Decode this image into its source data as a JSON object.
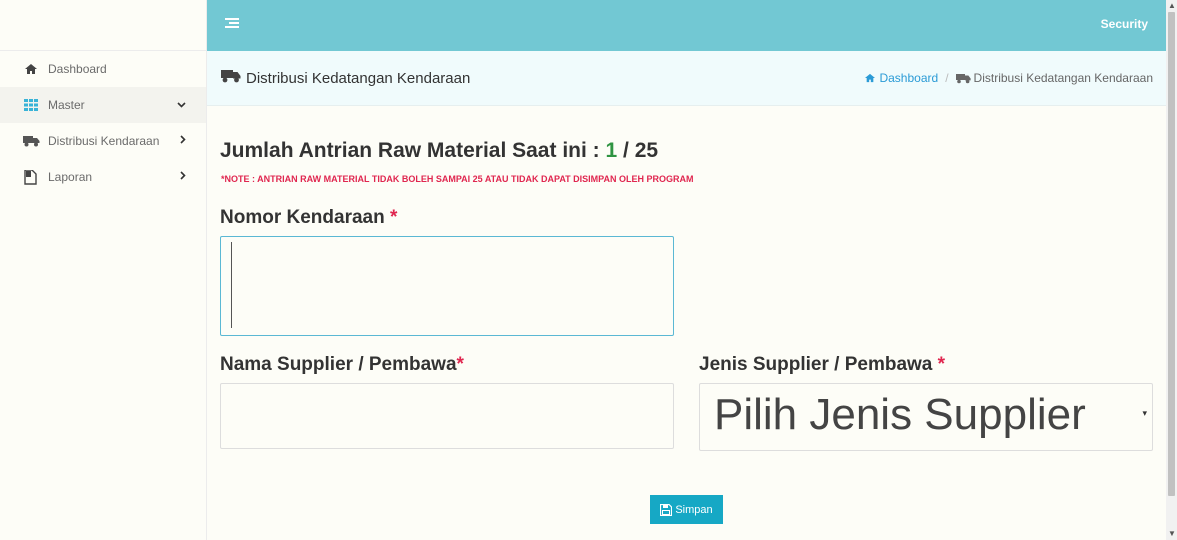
{
  "sidebar": {
    "items": [
      {
        "label": "Dashboard",
        "icon": "home-icon",
        "has_chevron": false
      },
      {
        "label": "Master",
        "icon": "grid-icon",
        "chevron": "down"
      },
      {
        "label": "Distribusi Kendaraan",
        "icon": "truck-icon",
        "chevron": "right"
      },
      {
        "label": "Laporan",
        "icon": "document-icon",
        "chevron": "right"
      }
    ]
  },
  "topbar": {
    "user_label": "Security",
    "bg_color": "#72c8d3"
  },
  "page_header": {
    "title": "Distribusi Kedatangan Kendaraan",
    "breadcrumb": {
      "home": "Dashboard",
      "current": "Distribusi Kedatangan Kendaraan"
    }
  },
  "main": {
    "queue_label": "Jumlah Antrian Raw Material Saat ini :",
    "queue_current": "1",
    "queue_separator": "/",
    "queue_max": "25",
    "note": "*NOTE : ANTRIAN RAW MATERIAL TIDAK BOLEH SAMPAI 25 ATAU TIDAK DAPAT DISIMPAN OLEH PROGRAM",
    "nomor_label": "Nomor Kendaraan",
    "nomor_value": "",
    "nama_label": "Nama Supplier / Pembawa",
    "nama_value": "",
    "jenis_label": "Jenis Supplier / Pembawa",
    "jenis_selected": "Pilih Jenis Supplier",
    "required_mark": "*",
    "save_label": "Simpan"
  },
  "colors": {
    "accent": "#16a8c5",
    "required": "#e0264f",
    "queue_current": "#2f9442",
    "link": "#2b9bd6"
  }
}
